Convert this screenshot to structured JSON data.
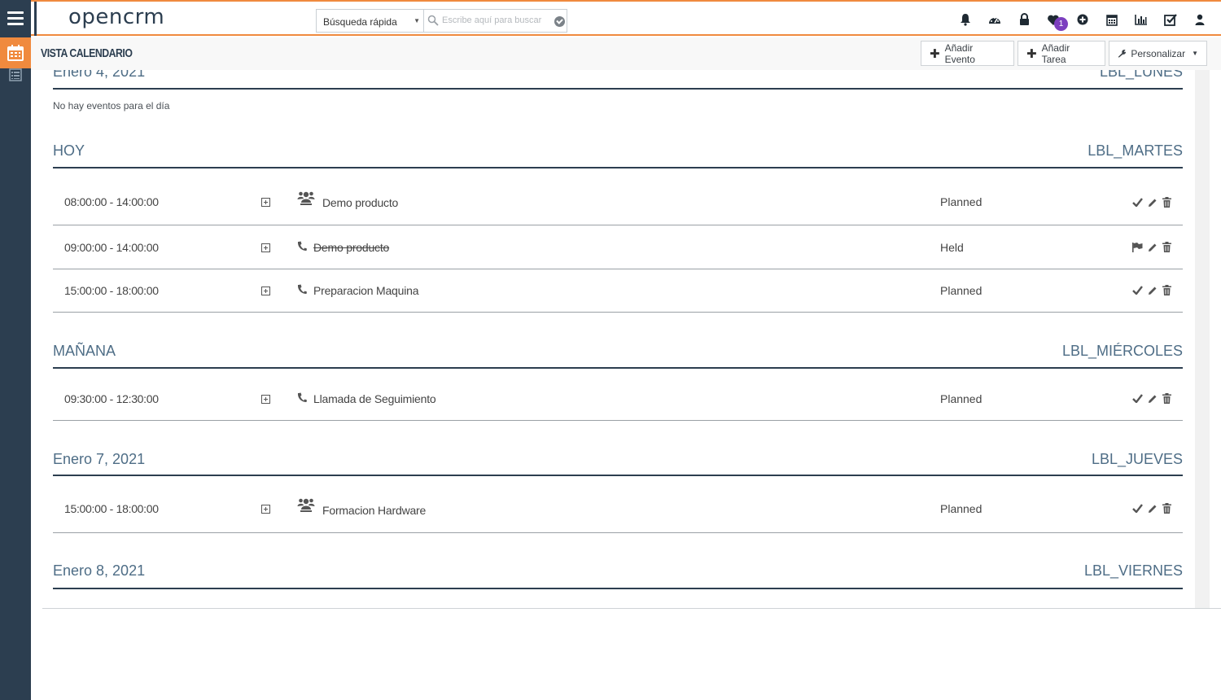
{
  "app": {
    "logo_text": "opencrm"
  },
  "header": {
    "quick_search_label": "Búsqueda rápida",
    "search_placeholder": "Escribe aquí para buscar",
    "notif_badge": "1",
    "icons": [
      "bell-icon",
      "dashboard-icon",
      "lock-icon",
      "heart-icon",
      "plus-circle-icon",
      "calendar-icon",
      "chart-icon",
      "checkbox-icon",
      "user-icon"
    ]
  },
  "subheader": {
    "title": "VISTA CALENDARIO",
    "add_event": "Añadir Evento",
    "add_task": "Añadir Tarea",
    "customize": "Personalizar"
  },
  "days": [
    {
      "label": "Enero 4, 2021",
      "weekday": "LBL_LUNES",
      "empty_text": "No hay eventos para el día",
      "events": []
    },
    {
      "label": "HOY",
      "weekday": "LBL_MARTES",
      "events": [
        {
          "time": "08:00:00 - 14:00:00",
          "type": "meeting",
          "subject": "Demo producto",
          "status": "Planned",
          "held": false
        },
        {
          "time": "09:00:00 - 14:00:00",
          "type": "call",
          "subject": "Demo producto",
          "status": "Held",
          "held": true
        },
        {
          "time": "15:00:00 - 18:00:00",
          "type": "call",
          "subject": "Preparacion Maquina",
          "status": "Planned",
          "held": false
        }
      ]
    },
    {
      "label": "MAÑANA",
      "weekday": "LBL_MIÉRCOLES",
      "events": [
        {
          "time": "09:30:00 - 12:30:00",
          "type": "call",
          "subject": "Llamada de Seguimiento",
          "status": "Planned",
          "held": false
        }
      ]
    },
    {
      "label": "Enero 7, 2021",
      "weekday": "LBL_JUEVES",
      "events": [
        {
          "time": "15:00:00 - 18:00:00",
          "type": "meeting",
          "subject": "Formacion Hardware",
          "status": "Planned",
          "held": false
        }
      ]
    },
    {
      "label": "Enero 8, 2021",
      "weekday": "LBL_VIERNES",
      "events": []
    }
  ],
  "colors": {
    "accent": "#f08a3e",
    "rail": "#2c3e50",
    "day_heading": "#4e6d86",
    "badge": "#7c3fbf"
  }
}
